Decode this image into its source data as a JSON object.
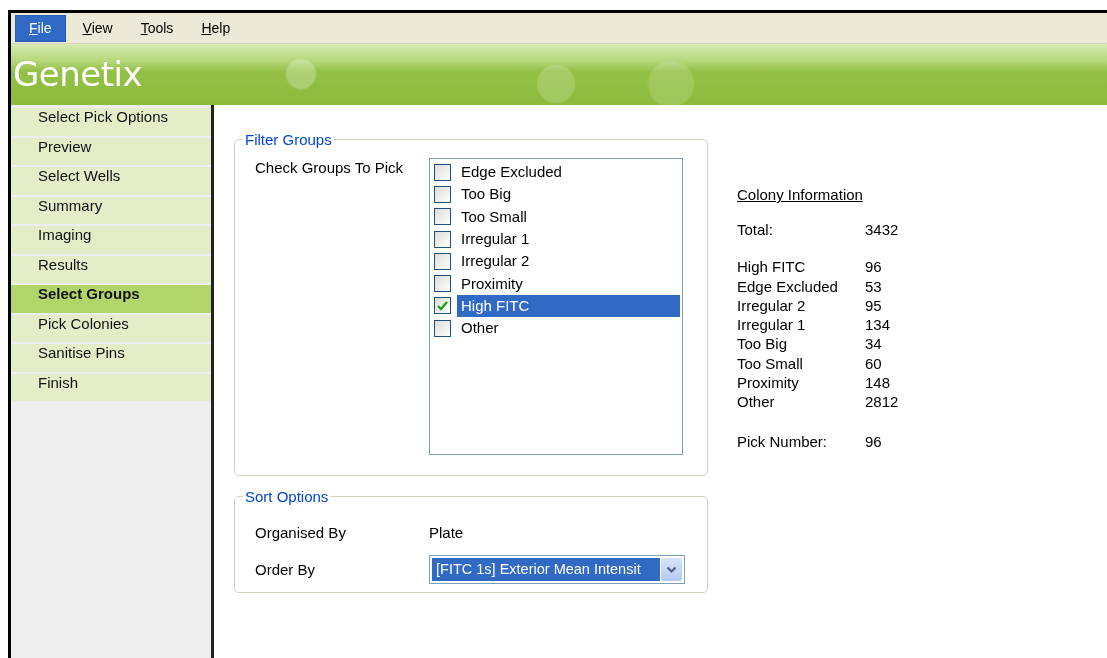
{
  "menu": [
    {
      "label": "File",
      "selected": true
    },
    {
      "label": "View",
      "selected": false
    },
    {
      "label": "Tools",
      "selected": false
    },
    {
      "label": "Help",
      "selected": false
    }
  ],
  "header": {
    "logo": "Genetix"
  },
  "sidebar": {
    "items": [
      {
        "label": "Select Pick Options",
        "selected": false
      },
      {
        "label": "Preview",
        "selected": false
      },
      {
        "label": "Select Wells",
        "selected": false
      },
      {
        "label": "Summary",
        "selected": false
      },
      {
        "label": "Imaging",
        "selected": false
      },
      {
        "label": "Results",
        "selected": false
      },
      {
        "label": "Select Groups",
        "selected": true
      },
      {
        "label": "Pick Colonies",
        "selected": false
      },
      {
        "label": "Sanitise Pins",
        "selected": false
      },
      {
        "label": "Finish",
        "selected": false
      }
    ]
  },
  "filter_groups": {
    "title": "Filter Groups",
    "label": "Check Groups To Pick",
    "items": [
      {
        "label": "Edge Excluded",
        "checked": false,
        "selected": false
      },
      {
        "label": "Too Big",
        "checked": false,
        "selected": false
      },
      {
        "label": "Too Small",
        "checked": false,
        "selected": false
      },
      {
        "label": "Irregular 1",
        "checked": false,
        "selected": false
      },
      {
        "label": "Irregular 2",
        "checked": false,
        "selected": false
      },
      {
        "label": "Proximity",
        "checked": false,
        "selected": false
      },
      {
        "label": "High FITC",
        "checked": true,
        "selected": true
      },
      {
        "label": "Other",
        "checked": false,
        "selected": false
      }
    ]
  },
  "sort_options": {
    "title": "Sort Options",
    "rows": [
      {
        "kind": "text",
        "label": "Organised By",
        "value": "Plate"
      },
      {
        "kind": "dropdown",
        "label": "Order By",
        "value": "[FITC 1s] Exterior Mean Intensit",
        "focused": true
      }
    ]
  },
  "colony_information": {
    "title": "Colony Information",
    "total": {
      "label": "Total:",
      "value": "3432"
    },
    "groups": [
      {
        "label": "High FITC",
        "value": "96"
      },
      {
        "label": "Edge Excluded",
        "value": "53"
      },
      {
        "label": "Irregular 2",
        "value": "95"
      },
      {
        "label": "Irregular 1",
        "value": "134"
      },
      {
        "label": "Too Big",
        "value": "34"
      },
      {
        "label": "Too Small",
        "value": "60"
      },
      {
        "label": "Proximity",
        "value": "148"
      },
      {
        "label": "Other",
        "value": "2812"
      }
    ],
    "pick_number": {
      "label": "Pick Number:",
      "value": "96"
    }
  }
}
